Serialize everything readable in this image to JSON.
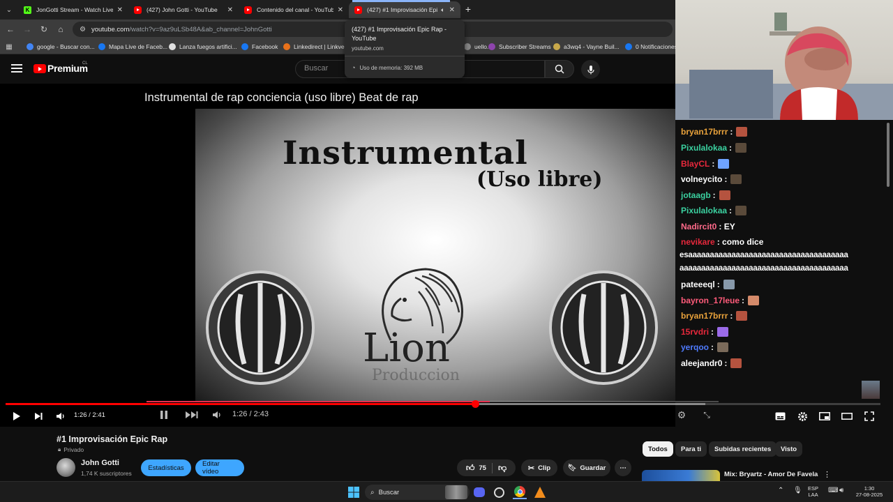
{
  "browser": {
    "tabs": [
      {
        "title": "JonGotti Stream - Watch Live o",
        "favicon": "kick-icon",
        "active": false
      },
      {
        "title": "(427) John Gotti - YouTube",
        "favicon": "youtube-icon",
        "active": false
      },
      {
        "title": "Contenido del canal - YouTube",
        "favicon": "youtube-icon",
        "active": false
      },
      {
        "title": "(427) #1 Improvisación Epi",
        "favicon": "youtube-icon",
        "active": true
      }
    ],
    "new_tab_label": "+",
    "url_host": "youtube.com",
    "url_rest": "/watch?v=9az9uLSb48A&ab_channel=JohnGotti",
    "bookmarks": [
      {
        "label": "google - Buscar con...",
        "color": "#4285f4"
      },
      {
        "label": "Mapa Live de Faceb...",
        "color": "#1877f2"
      },
      {
        "label": "Lanza fuegos artifici...",
        "color": "#e0e0e0"
      },
      {
        "label": "Facebook",
        "color": "#1877f2"
      },
      {
        "label": "Linkedirect | Linkve...",
        "color": "#e8711a"
      },
      {
        "label": "uello...",
        "color": "#888888"
      },
      {
        "label": "Subscriber Streams",
        "color": "#8e44ad"
      },
      {
        "label": "a3wq4 - Vayne Buil...",
        "color": "#c8a84a"
      },
      {
        "label": "0 Notificaciones",
        "color": "#1877f2"
      }
    ],
    "hovercard": {
      "title": "(427) #1 Improvisación Epic Rap - YouTube",
      "domain": "youtube.com",
      "memory": "Uso de memoria: 392 MB"
    }
  },
  "youtube": {
    "brand": "Premium",
    "country": "CL",
    "search_placeholder": "Buscar",
    "video": {
      "overlay_title": "Instrumental de rap conciencia (uso libre) Beat de rap",
      "thumb_heading": "Instrumental",
      "thumb_sub": "(Uso libre)",
      "thumb_word": "Lion",
      "thumb_word2": "Produccion",
      "time": "1:26 / 2:41",
      "inner_time": "1:26 / 2:43",
      "progress_played": 0.537,
      "progress_loaded": 0.8,
      "inner_played": 0.6
    },
    "title": "#1 Improvisación Epic Rap",
    "privacy": "Privado",
    "channel": {
      "name": "John Gotti",
      "subs": "1,74 K suscriptores"
    },
    "buttons": {
      "stats": "Estadísticas",
      "edit": "Editar vídeo",
      "likes": "75",
      "clip": "Clip",
      "save": "Guardar"
    },
    "filters": [
      "Todos",
      "Para ti",
      "Subidas recientes",
      "Visto"
    ],
    "rec_title": "Mix: Bryartz - Amor De Favela"
  },
  "chat": [
    {
      "user": "bryan17brrr",
      "color": "#e9a23b",
      "text": ":",
      "emote": "#b5533f"
    },
    {
      "user": "Pixulalokaa",
      "color": "#3bd1a0",
      "text": ":",
      "emote": "#5a4a3a"
    },
    {
      "user": "BlayCL",
      "color": "#e8283c",
      "text": ":",
      "emote": "#6fa3ff"
    },
    {
      "user": "volneycito",
      "color": "#ffffff",
      "text": ":",
      "emote": "#5a4a3a"
    },
    {
      "user": "jotaagb",
      "color": "#3bd1a0",
      "text": ":",
      "emote": "#b5533f"
    },
    {
      "user": "Pixulalokaa",
      "color": "#3bd1a0",
      "text": ":",
      "emote": "#5a4a3a"
    },
    {
      "user": "Nadircit0",
      "color": "#ff6a8a",
      "text": ": EY",
      "emote": ""
    },
    {
      "user": "nevikare",
      "color": "#e8283c",
      "text": ": como dice",
      "emote": ""
    },
    {
      "user": "pateeeql",
      "color": "#ffffff",
      "text": ":",
      "emote": "#8899aa"
    },
    {
      "user": "bayron_17leue",
      "color": "#ff5b7a",
      "text": ":",
      "emote": "#d48a6a"
    },
    {
      "user": "bryan17brrr",
      "color": "#e9a23b",
      "text": ":",
      "emote": "#b5533f"
    },
    {
      "user": "15rvdri",
      "color": "#e8283c",
      "text": ":",
      "emote": "#9b6be8"
    },
    {
      "user": "yerqoo",
      "color": "#4f7bff",
      "text": ":",
      "emote": "#7a6a5a"
    },
    {
      "user": "aleejandr0",
      "color": "#ffffff",
      "text": ":",
      "emote": "#b5533f"
    }
  ],
  "chat_long_1": "esaaaaaaaaaaaaaaaaaaaaaaaaaaaaaaaaaaaaa",
  "chat_long_2": "aaaaaaaaaaaaaaaaaaaaaaaaaaaaaaaaaaaaaaa",
  "taskbar": {
    "search": "Buscar",
    "lang_top": "ESP",
    "lang_bottom": "LAA",
    "time": "1:30",
    "date": "27-08-2025"
  }
}
